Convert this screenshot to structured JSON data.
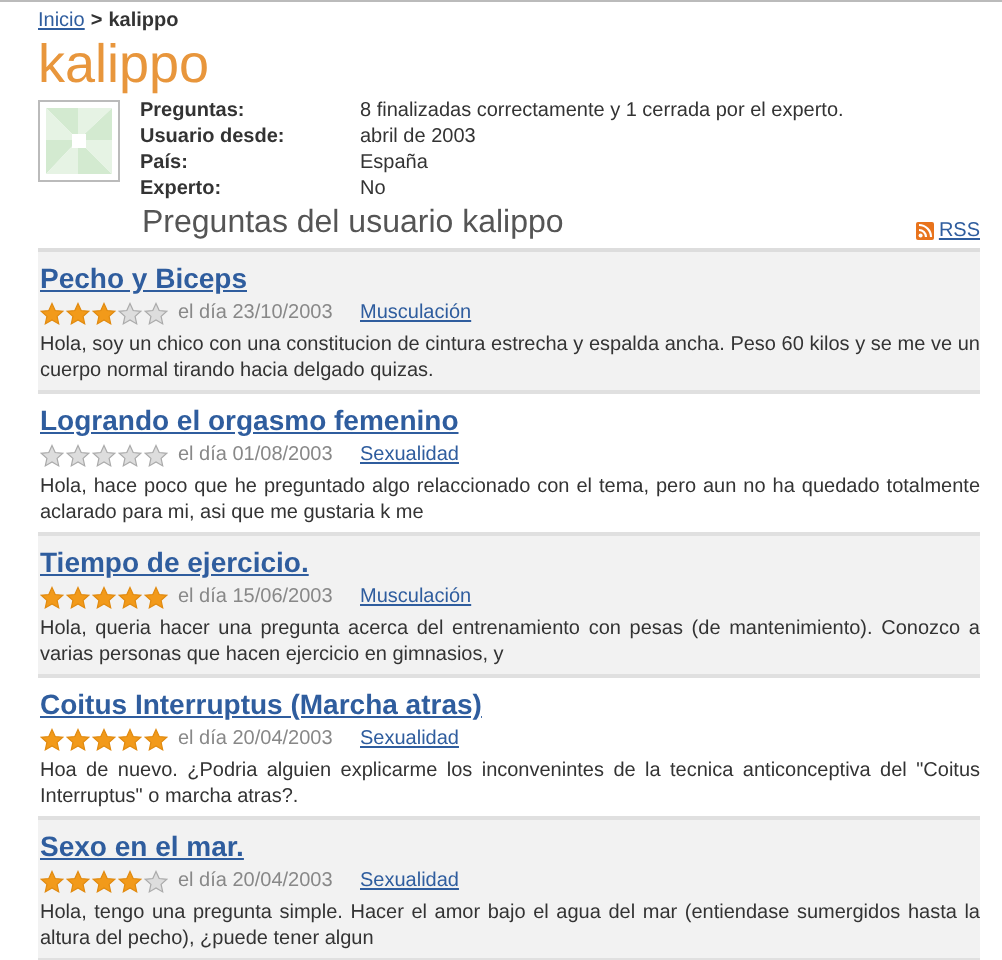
{
  "breadcrumb": {
    "link": "Inicio",
    "separator": ">",
    "current": "kalippo"
  },
  "title": "kalippo",
  "profile": [
    {
      "label": "Preguntas:",
      "value": "8 finalizadas correctamente y 1 cerrada por el experto."
    },
    {
      "label": "Usuario desde:",
      "value": "abril de 2003"
    },
    {
      "label": "País:",
      "value": "España"
    },
    {
      "label": "Experto:",
      "value": "No"
    }
  ],
  "section_title": "Preguntas del usuario kalippo",
  "rss": "RSS",
  "questions": [
    {
      "title": "Pecho y Biceps",
      "stars": 3,
      "date": "el día 23/10/2003",
      "category": "Musculación",
      "text": "Hola, soy un chico con una constitucion de cintura estrecha y espalda ancha. Peso 60 kilos y se me ve un cuerpo normal tirando hacia delgado quizas."
    },
    {
      "title": "Logrando el orgasmo femenino",
      "stars": 0,
      "date": "el día 01/08/2003",
      "category": "Sexualidad",
      "text": "Hola, hace poco que he preguntado algo relaccionado con el tema, pero aun no ha quedado totalmente aclarado para mi, asi que me gustaria k me"
    },
    {
      "title": "Tiempo de ejercicio.",
      "stars": 5,
      "date": "el día 15/06/2003",
      "category": "Musculación",
      "text": "Hola, queria hacer una pregunta acerca del entrenamiento con pesas (de mantenimiento). Conozco a varias personas que hacen ejercicio en gimnasios, y"
    },
    {
      "title": "Coitus Interruptus (Marcha atras)",
      "stars": 5,
      "date": "el día 20/04/2003",
      "category": "Sexualidad",
      "text": "Hoa de nuevo. ¿Podria alguien explicarme los inconvenintes de la tecnica anticonceptiva del \"Coitus Interruptus\" o marcha atras?."
    },
    {
      "title": "Sexo en el mar.",
      "stars": 4,
      "date": "el día 20/04/2003",
      "category": "Sexualidad",
      "text": "Hola, tengo una pregunta simple. Hacer el amor bajo el agua del mar (entiendase sumergidos hasta la altura del pecho), ¿puede tener algun"
    }
  ]
}
